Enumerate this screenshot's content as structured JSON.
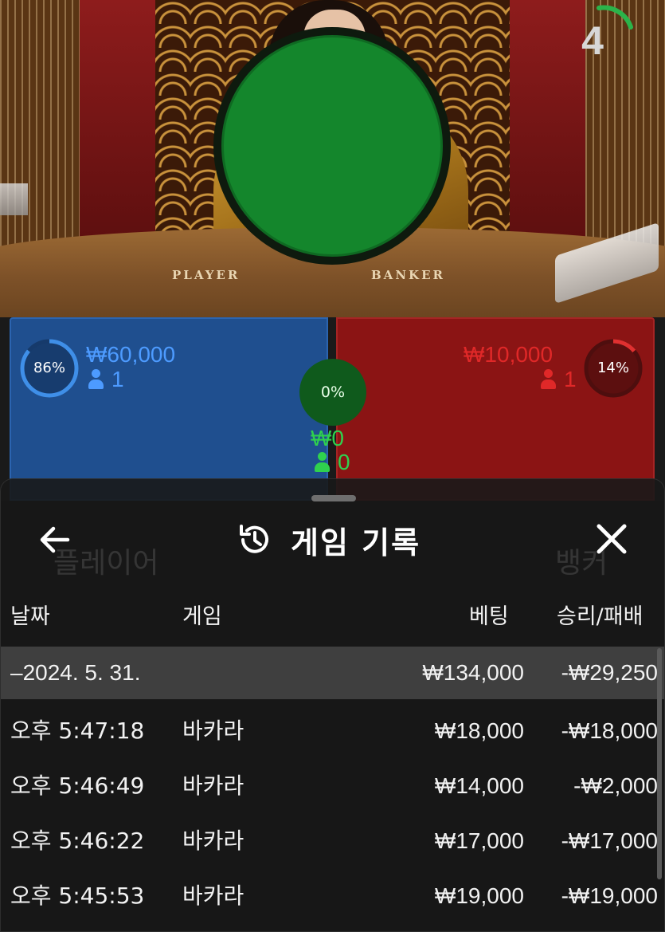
{
  "scene": {
    "countdown": "4",
    "table_labels": [
      "PLAYER",
      "BANKER"
    ]
  },
  "bets": {
    "player": {
      "percent": "86%",
      "percent_value": 0.86,
      "amount": "₩60,000",
      "count": "1",
      "color": "#1f4f8f"
    },
    "banker": {
      "percent": "14%",
      "percent_value": 0.14,
      "amount": "₩10,000",
      "count": "1",
      "color": "#8b1414"
    },
    "tie": {
      "percent": "0%",
      "percent_value": 0,
      "amount": "₩0",
      "count": "0",
      "color": "#14862c"
    }
  },
  "background_labels": [
    "플레이어",
    "뱅커"
  ],
  "history": {
    "title": "게임 기록",
    "icons": {
      "back": "back-arrow-icon",
      "history": "history-icon",
      "close": "close-icon"
    },
    "columns": {
      "date": "날짜",
      "game": "게임",
      "bet": "베팅",
      "result": "승리/패배"
    },
    "date_row": {
      "date": "–2024. 5. 31.",
      "bet": "₩134,000",
      "result": "-₩29,250"
    },
    "rows": [
      {
        "time": "오후 5:47:18",
        "game": "바카라",
        "bet": "₩18,000",
        "result": "-₩18,000"
      },
      {
        "time": "오후 5:46:49",
        "game": "바카라",
        "bet": "₩14,000",
        "result": "-₩2,000"
      },
      {
        "time": "오후 5:46:22",
        "game": "바카라",
        "bet": "₩17,000",
        "result": "-₩17,000"
      },
      {
        "time": "오후 5:45:53",
        "game": "바카라",
        "bet": "₩19,000",
        "result": "-₩19,000"
      }
    ]
  }
}
